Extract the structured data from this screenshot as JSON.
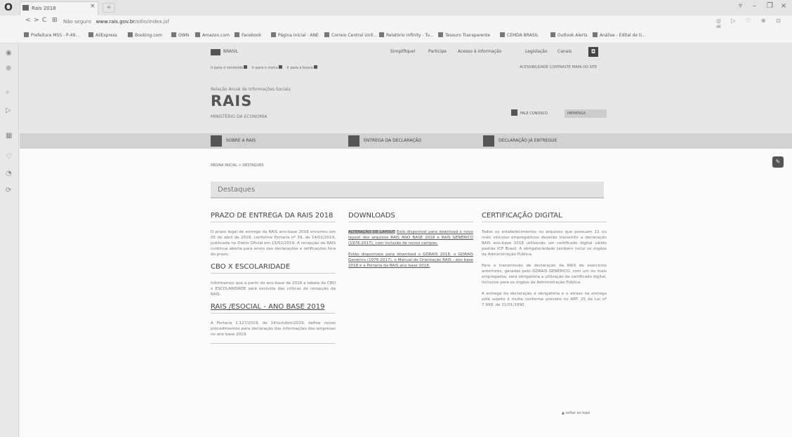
{
  "browser": {
    "tab_title": "Rais 2018",
    "tab_close": "×",
    "new_tab": "+",
    "nav": {
      "back": "<",
      "forward": ">",
      "reload": "C",
      "grid": "⊞"
    },
    "url_prefix": "Não seguro",
    "url_domain": "www.rais.gov.br",
    "url_path": "/sitio/index.jsf",
    "window_controls": [
      "▿",
      "–",
      "❐",
      "×"
    ],
    "bookmarks": [
      "Prefeitura MSS - P-49...",
      "AliExpress",
      "Booking.com",
      "OWN",
      "Amazon.com",
      "Facebook",
      "Página Inicial - ANE",
      "Correio Central Unit...",
      "Relatório Infinity - Tu...",
      "Tesouro Transparente",
      "CEMDA BRASIL",
      "Outlook Alerts",
      "Análise - Edital de ti..."
    ],
    "sidebar_icons": [
      "◉",
      "⊕",
      "⌕",
      "▷",
      "▦",
      "♡",
      "◔",
      "⟳"
    ]
  },
  "gov_bar": {
    "brasil": "BRASIL",
    "links": [
      "Simplifique!",
      "Participe",
      "Acesso à informação",
      "Legislação",
      "Canais"
    ]
  },
  "accessibility": {
    "links": [
      "Ir para o conteúdo",
      "Ir para o menu",
      "Ir para a busca"
    ],
    "alto_contraste": "ACESSIBILIDADE  CONTRASTE  MAPA DO SITE"
  },
  "header": {
    "subtitle": "Relação Anual de Informações Sociais",
    "title": "RAIS",
    "ministry": "MINISTÉRIO DA ECONOMIA",
    "fale_conosco": "FALE CONOSCO",
    "imprensa": "IMPRENSA"
  },
  "menu": [
    {
      "label": "SOBRE A RAIS"
    },
    {
      "label": "ENTREGA DA DECLARAÇÃO"
    },
    {
      "label": "DECLARAÇÃO JÁ ENTREGUE"
    }
  ],
  "breadcrumb": "PÁGINA INICIAL  >  DESTAQUES",
  "destaques": "Destaques",
  "col1": {
    "h1": "PRAZO DE ENTREGA DA RAIS 2018",
    "p1": "O prazo legal de entrega da RAIS ano-base 2018 encerrou em 05 de abril de 2019, conforme Portaria nº 39, de 14/02/2019, publicada no Diário Oficial em 15/02/2019. A recepção da RAIS continua aberta para envio das declarações e retificações fora do prazo.",
    "h2": "CBO X ESCOLARIDADE",
    "p2": "Informamos que a partir do ano-base de 2018 a tabela de CBO x ESCOLARIDADE será excluída das críticas de recepção da RAIS.",
    "h3": "RAIS /ESOCIAL - ANO BASE 2019",
    "p3": "A Portaria 1.127/2019, de 14/outubro/2019, define novos procedimentos para declaração das informações das empresas no ano base 2019."
  },
  "col2": {
    "h1": "DOWNLOADS",
    "hl": "ALTERAÇÃO DE LAYOUT",
    "p1": "Está disponível para download o novo layout dos arquivos RAIS ANO BASE 2018 e RAIS GENÉRICO (1976-2017), com inclusão de novos campos.",
    "p2": "Estão disponíveis para download o GDRAIS 2018, o GDRAIS Genérico (1976-2017), o Manual de Orientação RAIS - ano base 2018 e a Portaria da RAIS ano base 2018."
  },
  "col3": {
    "h1": "CERTIFICAÇÃO DIGITAL",
    "p1": "Todos os estabelecimentos ou arquivos que possuam 11 ou mais vínculos empregatícios deverão transmitir a declaração RAIS ano-base 2018 utilizando um certificado digital válido padrão ICP Brasil. A obrigatoriedade também inclui os órgãos da Administração Pública.",
    "p2": "Para a transmissão de declaração da RAIS de exercícios anteriores, geradas pelo GDRAIS GENÉRICO, com um ou mais empregados, será obrigatória a utilização de certificado digital, inclusive para os órgãos da Administração Pública.",
    "p3": "A entrega da declaração é obrigatória e o atraso na entrega está sujeito à multa conforme previsto no ART. 25 da Lei nº 7.998, de 11/01/1990."
  },
  "voltar_topo": "▲ voltar ao topo"
}
